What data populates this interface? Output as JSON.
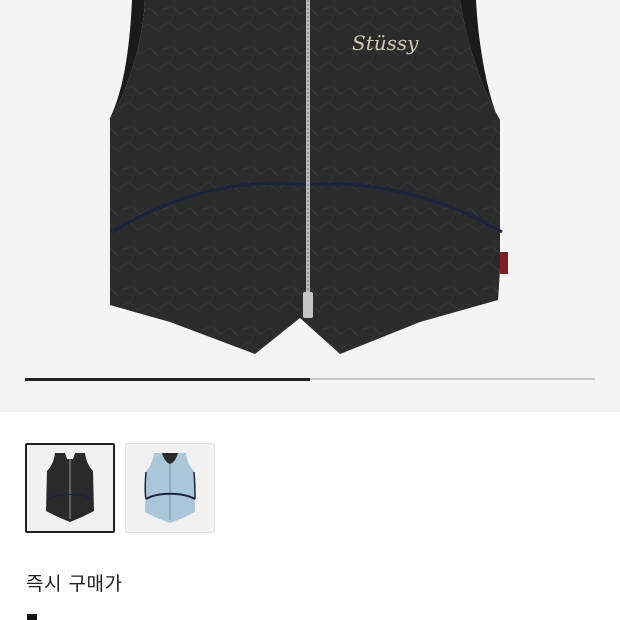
{
  "product": {
    "brand_logo": "Stüssy"
  },
  "gallery": {
    "progress_fraction": 0.5,
    "thumbnails": [
      {
        "name": "black-vest",
        "color": "#2a2a2a",
        "selected": true
      },
      {
        "name": "light-blue-vest",
        "color": "#a9c7d8",
        "selected": false
      }
    ]
  },
  "purchase": {
    "label": "즉시 구매가"
  },
  "colors": {
    "hero_background": "#f4f4f4",
    "vest_black": "#2b2b2b",
    "vest_light_blue": "#a9c7d8",
    "piping_navy": "#1c2340",
    "accent_text": "#222222"
  }
}
